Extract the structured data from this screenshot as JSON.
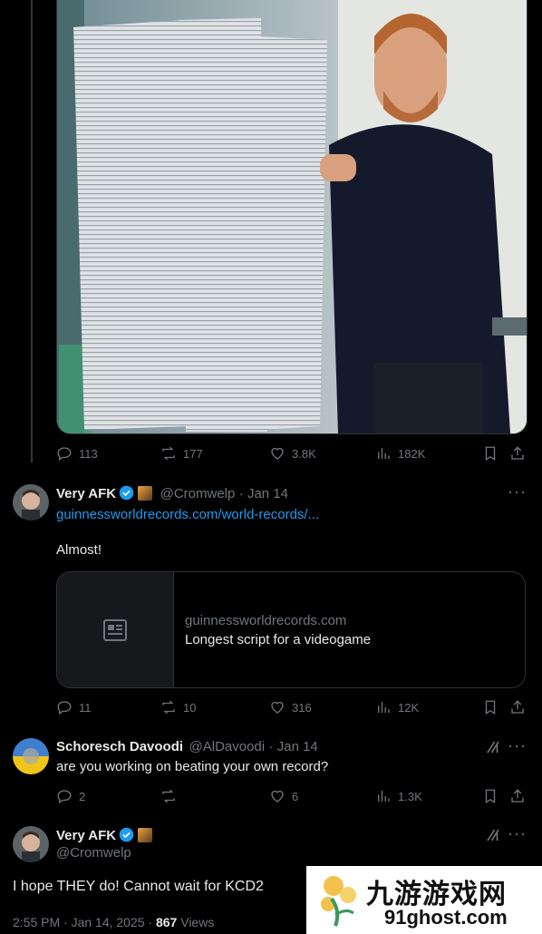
{
  "top_tweet": {
    "stats": {
      "replies": "113",
      "retweets": "177",
      "likes": "3.8K",
      "views": "182K"
    }
  },
  "reply1": {
    "display_name": "Very AFK",
    "handle": "@Cromwelp",
    "date": "· Jan 14",
    "link_text": "guinnessworldrecords.com/world-records/...",
    "text": "Almost!",
    "card": {
      "domain": "guinnessworldrecords.com",
      "title": "Longest script for a videogame"
    },
    "stats": {
      "replies": "11",
      "retweets": "10",
      "likes": "316",
      "views": "12K"
    }
  },
  "reply2": {
    "display_name": "Schoresch Davoodi",
    "handle": "@AlDavoodi",
    "date": "· Jan 14",
    "text": "are you working on beating your own record?",
    "stats": {
      "replies": "2",
      "retweets": "",
      "likes": "6",
      "views": "1.3K"
    }
  },
  "main_tweet": {
    "display_name": "Very AFK",
    "handle": "@Cromwelp",
    "text": "I hope THEY do! Cannot wait for KCD2",
    "time": "2:55 PM · Jan 14, 2025 ·",
    "views_count": "867",
    "views_label": "Views"
  },
  "watermark": {
    "cn": "九游游戏网",
    "url": "91ghost.com"
  },
  "colors": {
    "background": "#000000",
    "text": "#e7e9ea",
    "muted": "#71767b",
    "link": "#1d9bf0",
    "border": "#2f3336"
  }
}
